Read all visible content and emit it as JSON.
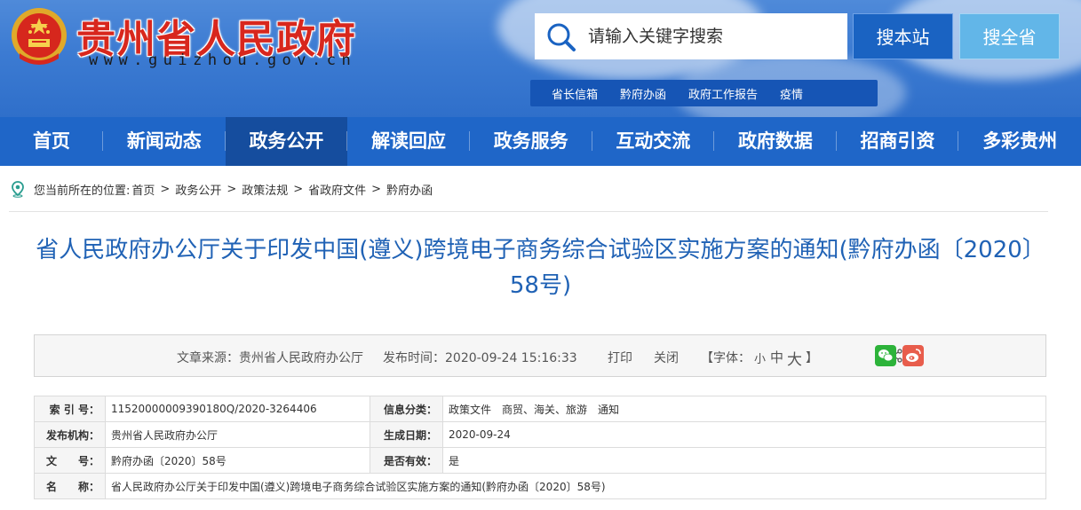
{
  "header": {
    "site_title": "贵州省人民政府",
    "site_url": "www.guizhou.gov.cn",
    "emblem": "national-emblem",
    "search": {
      "placeholder": "请输入关键字搜索",
      "value": ""
    },
    "search_site_button": "搜本站",
    "search_province_button": "搜全省",
    "quick_links": [
      "省长信箱",
      "黔府办函",
      "政府工作报告",
      "疫情"
    ]
  },
  "nav": {
    "items": [
      "首页",
      "新闻动态",
      "政务公开",
      "解读回应",
      "政务服务",
      "互动交流",
      "政府数据",
      "招商引资",
      "多彩贵州"
    ],
    "active": "政务公开"
  },
  "breadcrumb": {
    "prefix": "您当前所在的位置:",
    "items": [
      "首页",
      "政务公开",
      "政策法规",
      "省政府文件",
      "黔府办函"
    ],
    "separator": ">"
  },
  "article": {
    "title": "省人民政府办公厅关于印发中国(遵义)跨境电子商务综合试验区实施方案的通知(黔府办函〔2020〕58号)",
    "source": "文章来源：贵州省人民政府办公厅",
    "publish_time": "发布时间：2020-09-24 15:16:33",
    "print_label": "打印",
    "close_label": "关闭",
    "font_label_open": "【字体：",
    "font_small": "小",
    "font_medium": "中",
    "font_large": "大",
    "font_label_close": "】",
    "share_icons": [
      "share-icon",
      "wechat-icon",
      "weibo-icon"
    ],
    "font_active_color": "#d02020"
  },
  "info": {
    "index_label": "索 引 号：",
    "index_value": "11520000009390180Q/2020-3264406",
    "category_label": "信息分类：",
    "category_value": "政策文件　商贸、海关、旅游　通知",
    "issuer_label": "发布机构：",
    "issuer_value": "贵州省人民政府办公厅",
    "date_label": "生成日期：",
    "date_value": "2020-09-24",
    "docno_label": "文　　号：",
    "docno_value": "黔府办函〔2020〕58号",
    "valid_label": "是否有效：",
    "valid_value": "是",
    "name_label": "名　　称：",
    "name_value": "省人民政府办公厅关于印发中国(遵义)跨境电子商务综合试验区实施方案的通知(黔府办函〔2020〕58号)"
  },
  "colors": {
    "nav_bg": "#1f66c8",
    "nav_active_bg": "#154d9e",
    "title_red": "#d8271d",
    "article_title_blue": "#2062b5"
  }
}
